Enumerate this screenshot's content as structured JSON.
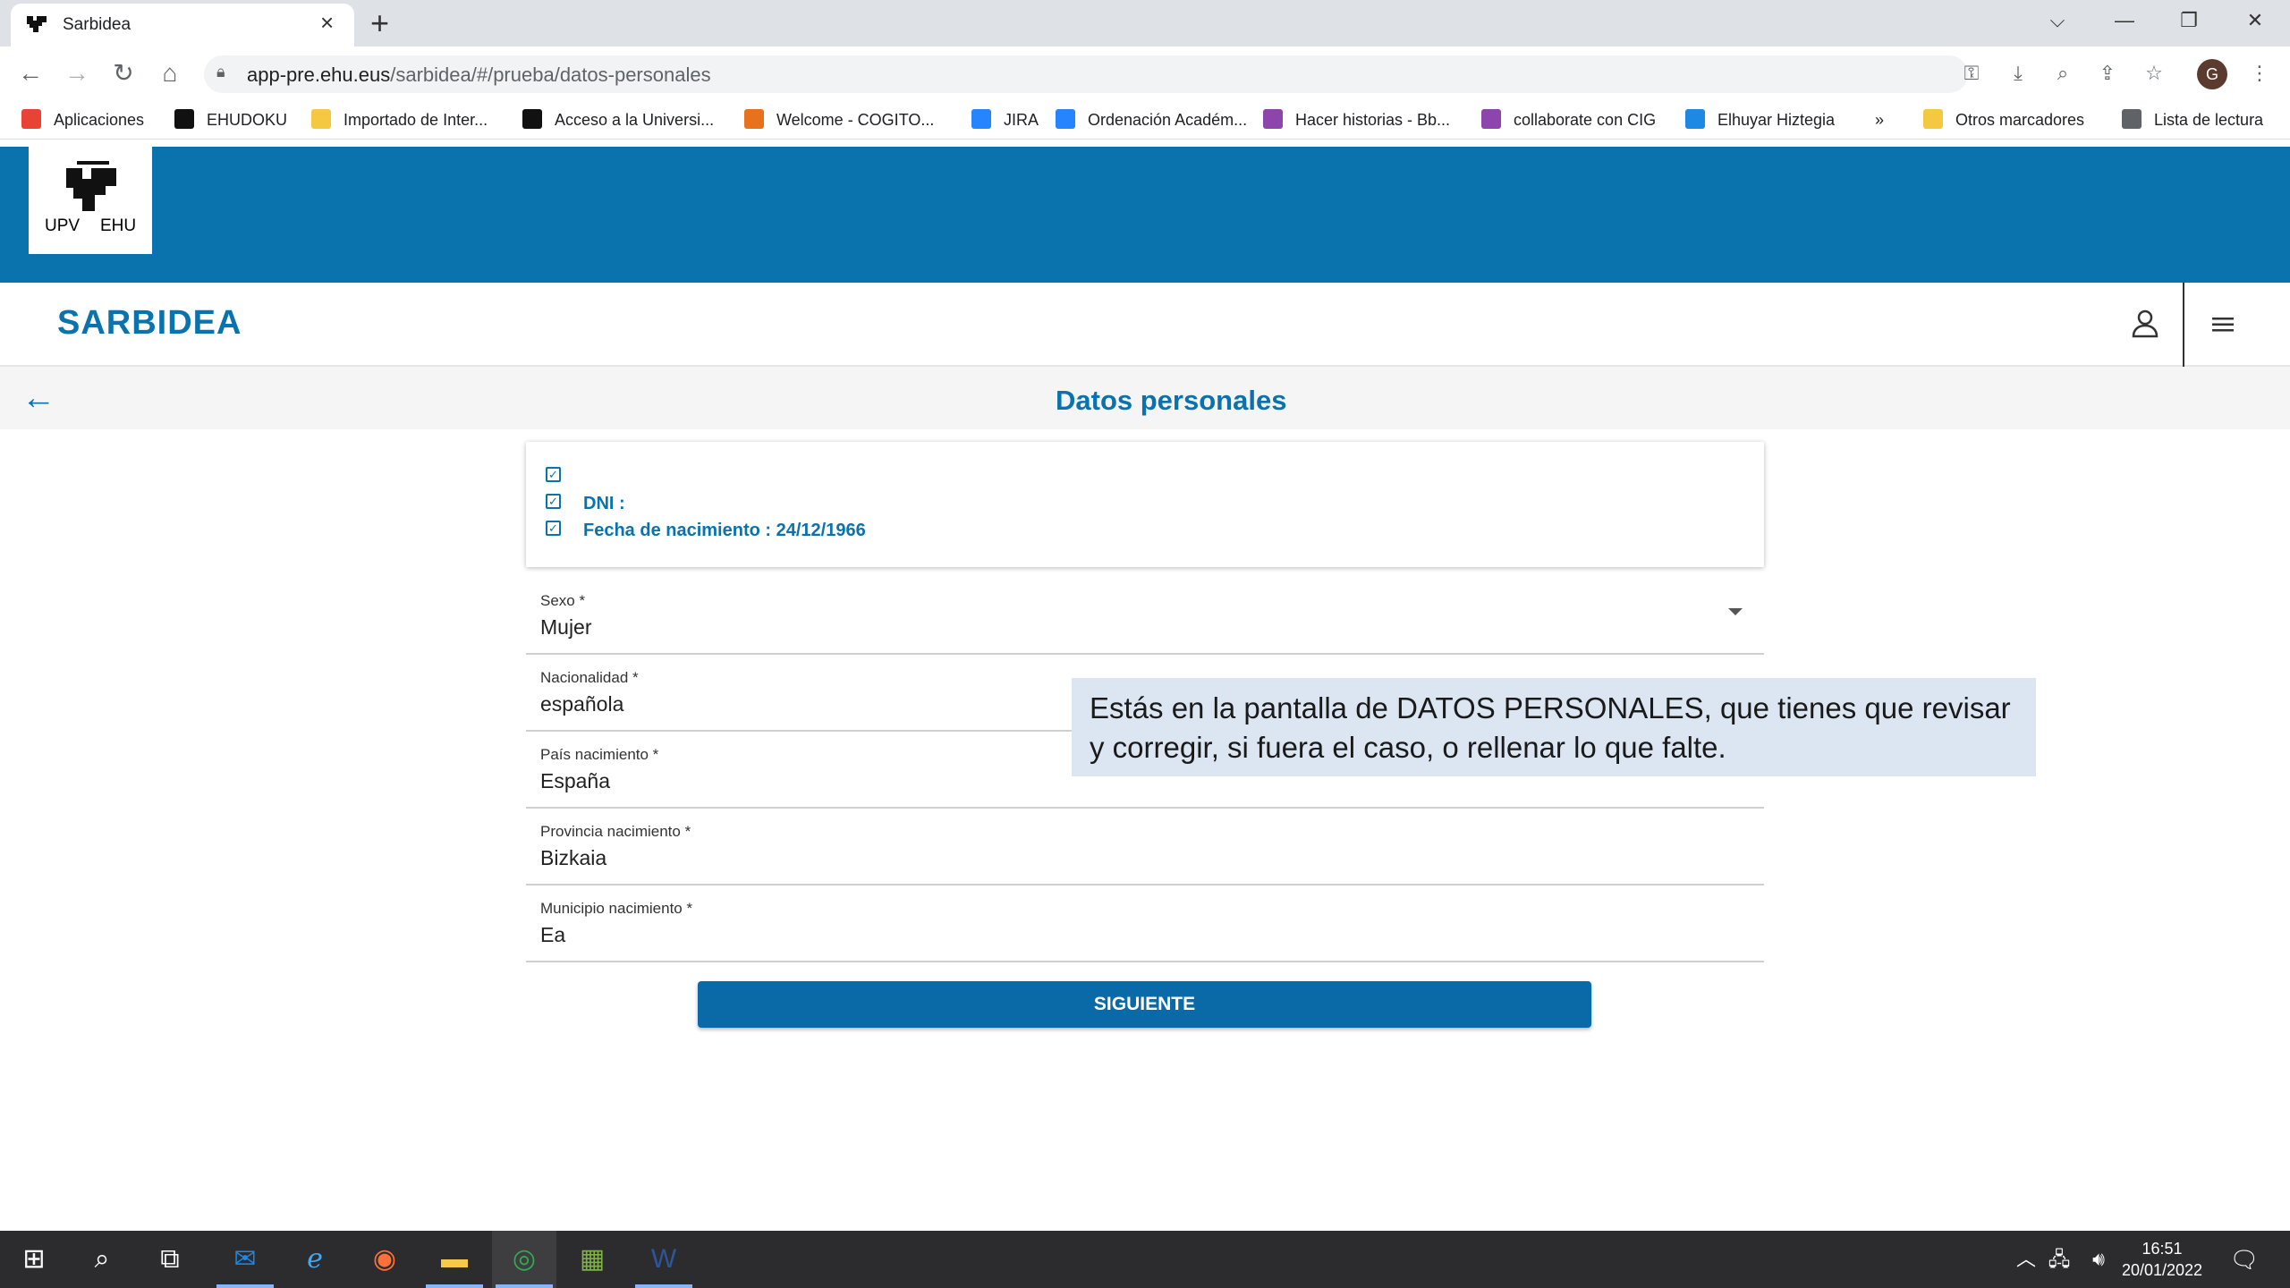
{
  "browser": {
    "tab_title": "Sarbidea",
    "tab_close": "×",
    "new_tab": "+",
    "url_host": "app-pre.ehu.eus",
    "url_path": "/sarbidea/#/prueba/datos-personales",
    "profile_initial": "G",
    "bookmarks": [
      {
        "label": "Aplicaciones",
        "color": "#e94335"
      },
      {
        "label": "EHUDOKU",
        "color": "#111111"
      },
      {
        "label": "Importado de Inter...",
        "color": "#f5c842"
      },
      {
        "label": "Acceso a la Universi...",
        "color": "#111111"
      },
      {
        "label": "Welcome - COGITO...",
        "color": "#e8711e"
      },
      {
        "label": "JIRA",
        "color": "#2684ff"
      },
      {
        "label": "Ordenación Académ...",
        "color": "#2684ff"
      },
      {
        "label": "Hacer historias - Bb...",
        "color": "#8e44ad"
      },
      {
        "label": "collaborate con CIG",
        "color": "#8e44ad"
      },
      {
        "label": "Elhuyar Hiztegia",
        "color": "#1e88e5"
      },
      {
        "label": "»",
        "color": "#ffffff"
      },
      {
        "label": "Otros marcadores",
        "color": "#f5c842"
      },
      {
        "label": "Lista de lectura",
        "color": "#5f6368"
      }
    ]
  },
  "header": {
    "logo_left": "UPV",
    "logo_right": "EHU",
    "app_name": "SARBIDEA",
    "brand_color": "#0a72ad"
  },
  "page": {
    "title": "Datos personales",
    "checklist": [
      {
        "label": "",
        "value": ""
      },
      {
        "label": "DNI :",
        "value": ""
      },
      {
        "label": "Fecha de nacimiento :",
        "value": "24/12/1966"
      }
    ],
    "fields": [
      {
        "label": "Sexo *",
        "value": "Mujer"
      },
      {
        "label": "Nacionalidad *",
        "value": "española"
      },
      {
        "label": "País nacimiento *",
        "value": "España"
      },
      {
        "label": "Provincia nacimiento *",
        "value": "Bizkaia"
      },
      {
        "label": "Municipio nacimiento *",
        "value": "Ea"
      }
    ],
    "next_button": "SIGUIENTE"
  },
  "tooltip": {
    "text": "Estás en la pantalla de DATOS PERSONALES, que tienes que revisar y corregir, si fuera el caso, o rellenar lo que falte."
  },
  "taskbar": {
    "time": "16:51",
    "date": "20/01/2022"
  }
}
